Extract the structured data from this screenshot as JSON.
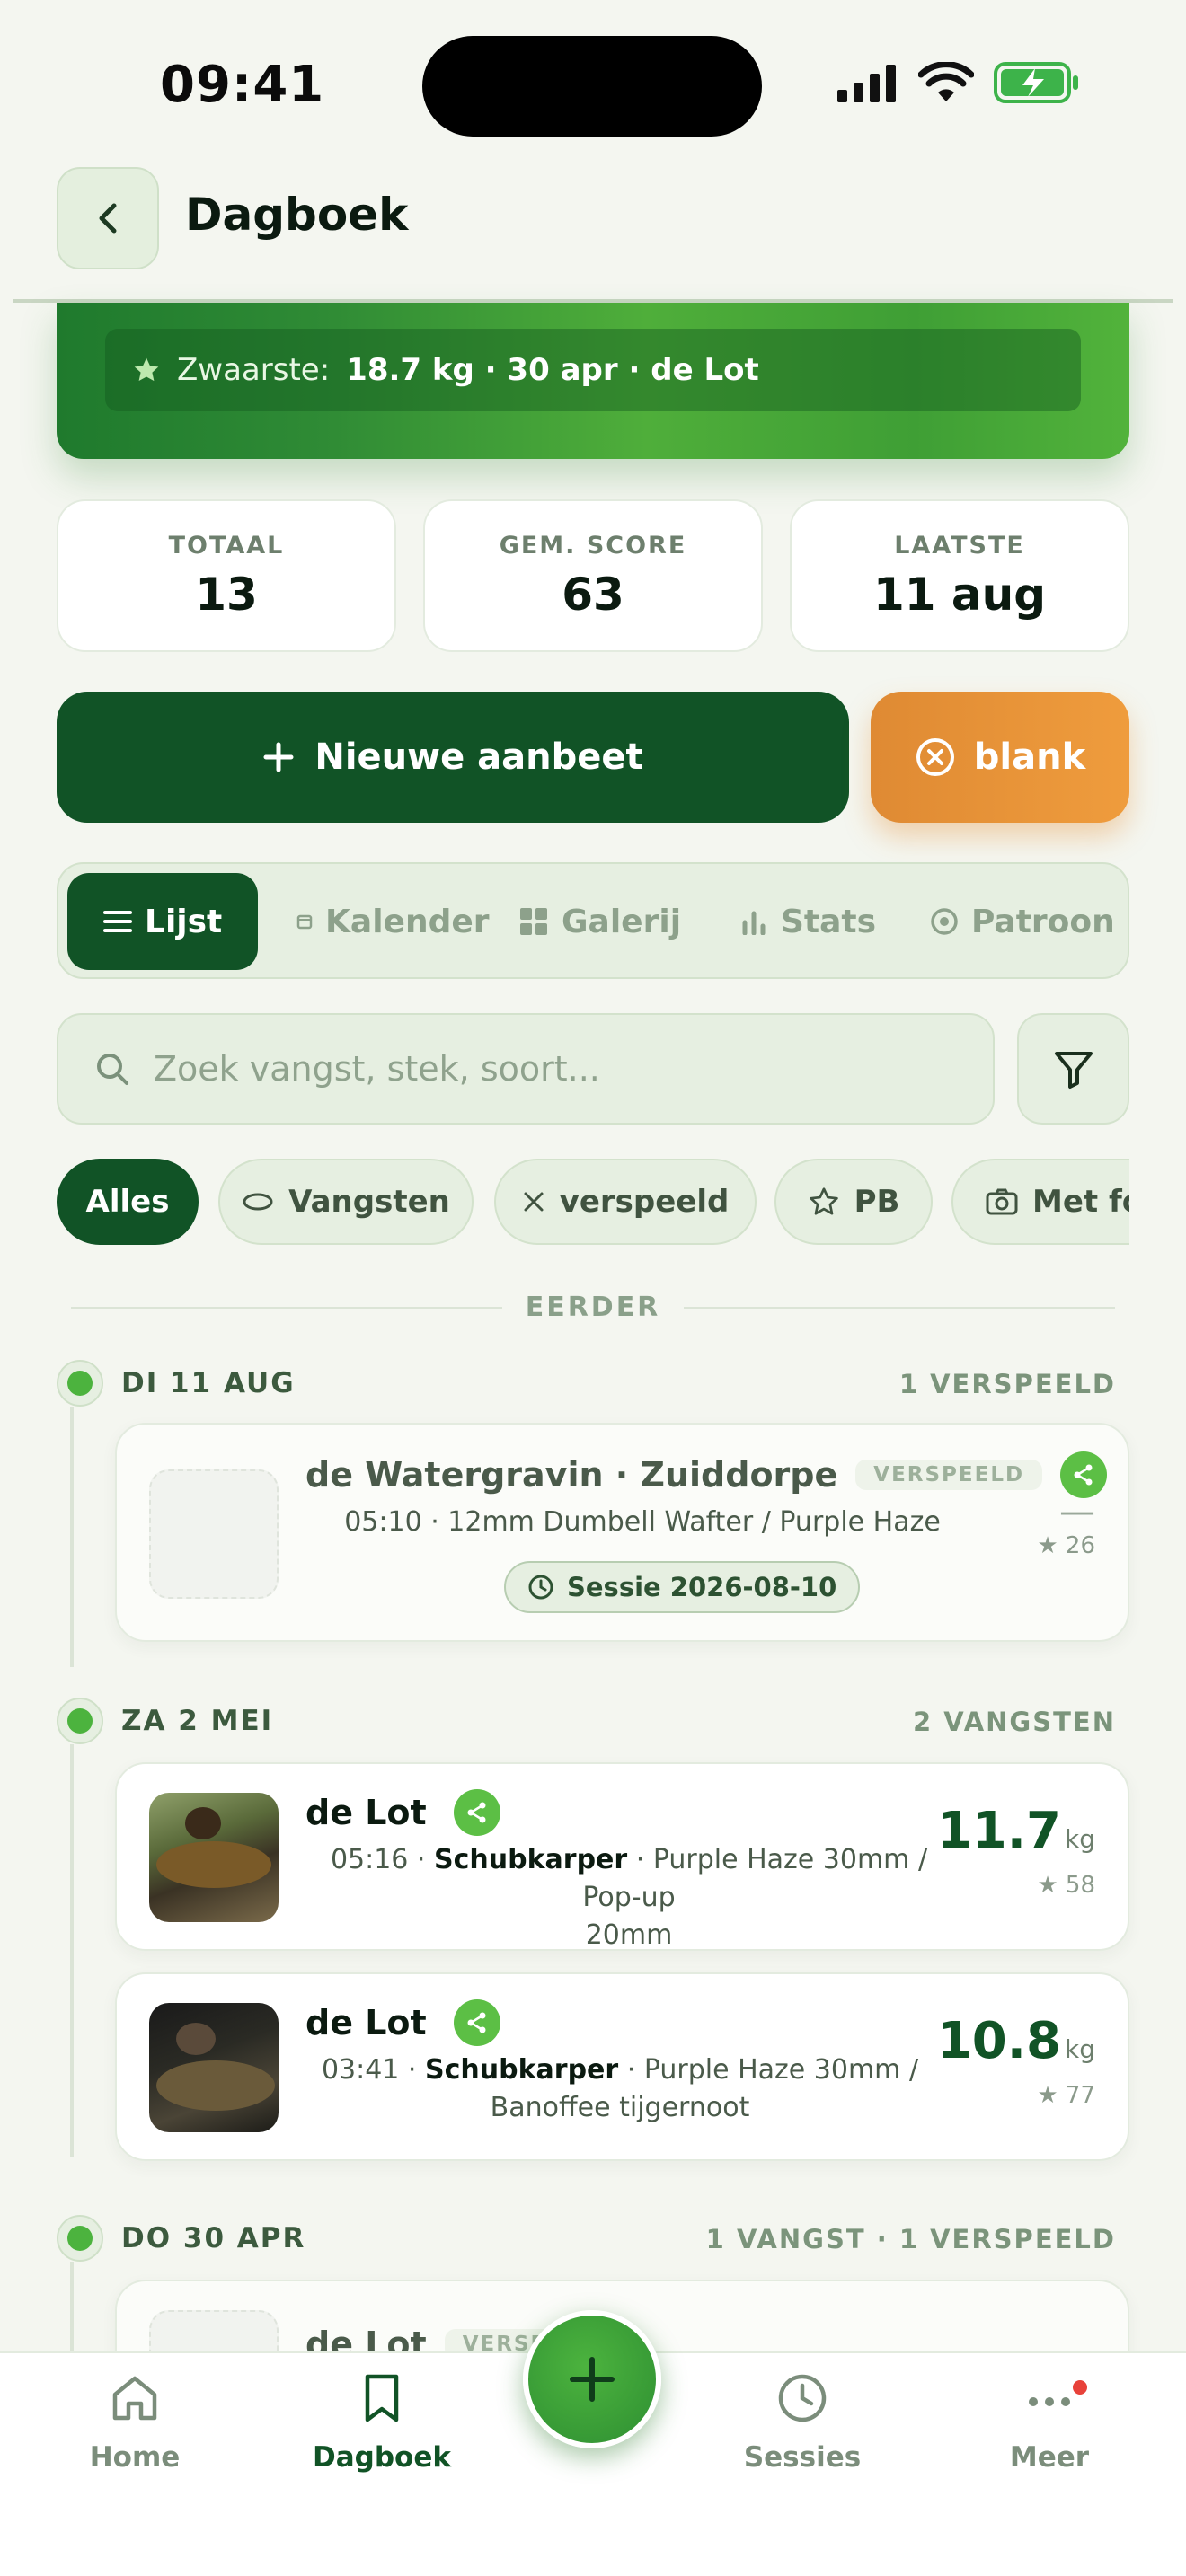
{
  "status": {
    "time": "09:41"
  },
  "header": {
    "title": "Dagboek"
  },
  "hero": {
    "label": "Zwaarste:",
    "value": "18.7 kg · 30 apr · de Lot"
  },
  "stats": [
    {
      "label": "TOTAAL",
      "value": "13"
    },
    {
      "label": "GEM. SCORE",
      "value": "63"
    },
    {
      "label": "LAATSTE",
      "value": "11 aug"
    }
  ],
  "actions": {
    "new_label": "Nieuwe aanbeet",
    "blank_label": "blank"
  },
  "tabs": [
    {
      "label": "Lijst",
      "icon": "list-icon"
    },
    {
      "label": "Kalender",
      "icon": "calendar-icon"
    },
    {
      "label": "Galerij",
      "icon": "grid-icon"
    },
    {
      "label": "Stats",
      "icon": "bar-chart-icon"
    },
    {
      "label": "Patroon",
      "icon": "target-icon"
    }
  ],
  "search": {
    "placeholder": "Zoek vangst, stek, soort..."
  },
  "chips": [
    {
      "label": "Alles"
    },
    {
      "label": "Vangsten"
    },
    {
      "label": "verspeeld"
    },
    {
      "label": "PB"
    },
    {
      "label": "Met fo"
    }
  ],
  "section": {
    "label": "EERDER"
  },
  "days": [
    {
      "label": "DI 11 AUG",
      "count": "1 VERSPEELD",
      "entries": [
        {
          "title": "de Watergravin · Zuiddorpe",
          "badge": "VERSPEELD",
          "meta": "05:10 · 12mm Dumbell Wafter / Purple Haze",
          "session": "Sessie 2026-08-10",
          "weight": "—",
          "score": "★ 26"
        }
      ]
    },
    {
      "label": "ZA 2 MEI",
      "count": "2 VANGSTEN",
      "entries": [
        {
          "title": "de Lot",
          "time": "05:16 ·",
          "species": "Schubkarper",
          "bait_1": "· Purple Haze 30mm / Pop-up",
          "bait_2": "20mm",
          "weight": "11.7",
          "unit": "kg",
          "score": "★ 58"
        },
        {
          "title": "de Lot",
          "time": "03:41 ·",
          "species": "Schubkarper",
          "bait_1": "· Purple Haze 30mm /",
          "bait_2": "Banoffee tijgernoot",
          "weight": "10.8",
          "unit": "kg",
          "score": "★ 77"
        }
      ]
    },
    {
      "label": "DO 30 APR",
      "count": "1 VANGST · 1 VERSPEELD",
      "entries": [
        {
          "title": "de Lot",
          "badge": "VERSPEELD"
        }
      ]
    }
  ],
  "nav": [
    {
      "label": "Home",
      "icon": "home-icon"
    },
    {
      "label": "Dagboek",
      "icon": "bookmark-icon"
    },
    {
      "label": "Sessies",
      "icon": "clock-icon"
    },
    {
      "label": "Meer",
      "icon": "more-icon"
    }
  ],
  "colors": {
    "primary": "#115326",
    "accent": "#4cb33e",
    "orange": "#e8923a",
    "background": "#f4f6f0"
  }
}
